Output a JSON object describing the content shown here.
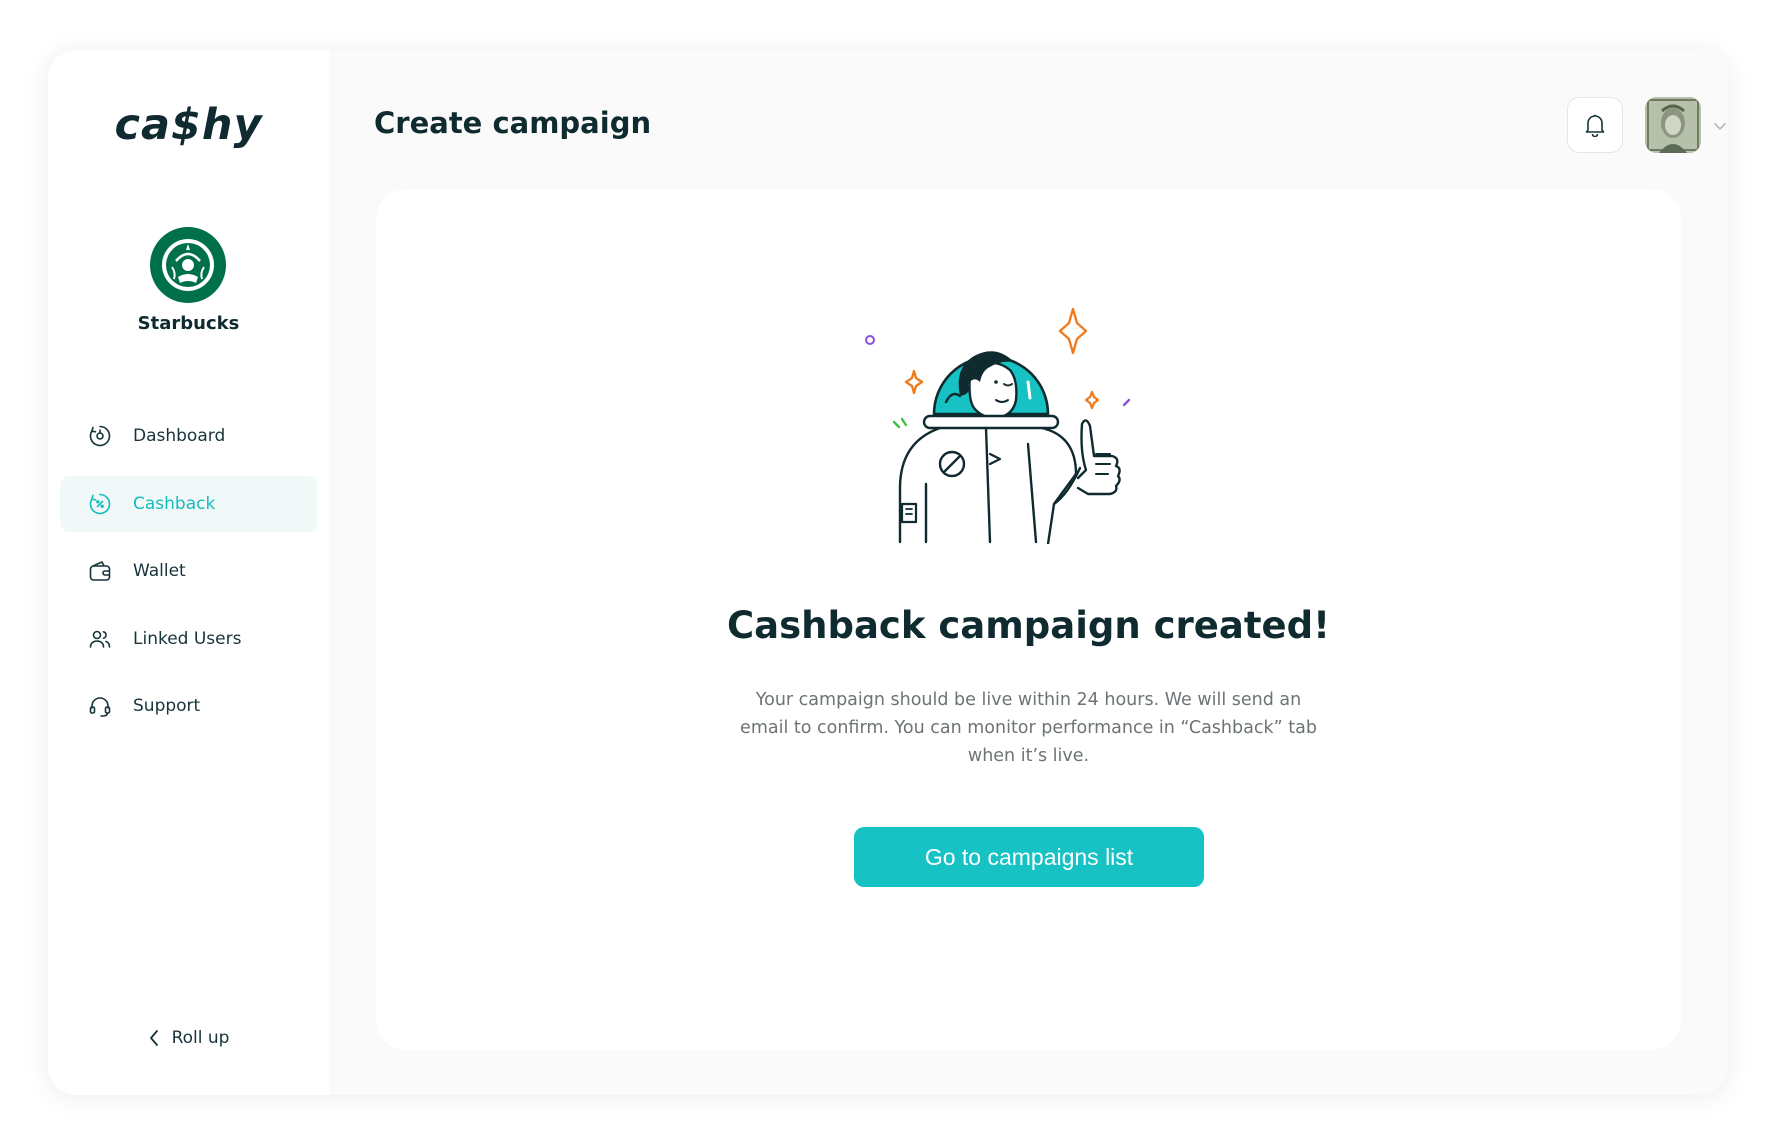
{
  "app": {
    "logo_text": "ca$hy"
  },
  "brand": {
    "name": "Starbucks",
    "avatar_icon": "starbucks-logo"
  },
  "sidebar": {
    "items": [
      {
        "label": "Dashboard",
        "icon": "dashboard-icon",
        "active": false
      },
      {
        "label": "Cashback",
        "icon": "cashback-icon",
        "active": true
      },
      {
        "label": "Wallet",
        "icon": "wallet-icon",
        "active": false
      },
      {
        "label": "Linked Users",
        "icon": "users-icon",
        "active": false
      },
      {
        "label": "Support",
        "icon": "headset-icon",
        "active": false
      }
    ],
    "rollup_label": "Roll up"
  },
  "header": {
    "title": "Create campaign",
    "notification_icon": "bell-icon",
    "user_menu_icon": "chevron-down-icon"
  },
  "success": {
    "headline": "Cashback campaign created!",
    "message": "Your campaign should be live within 24 hours. We will send an email to confirm. You can monitor performance in “Cashback” tab when it’s live.",
    "cta_label": "Go to campaigns list"
  },
  "colors": {
    "accent": "#16c2c4",
    "active_nav_bg": "#f1f8f8",
    "text_primary": "#0f2b2f",
    "text_secondary": "#6d7476",
    "brand_green": "#00704a"
  }
}
